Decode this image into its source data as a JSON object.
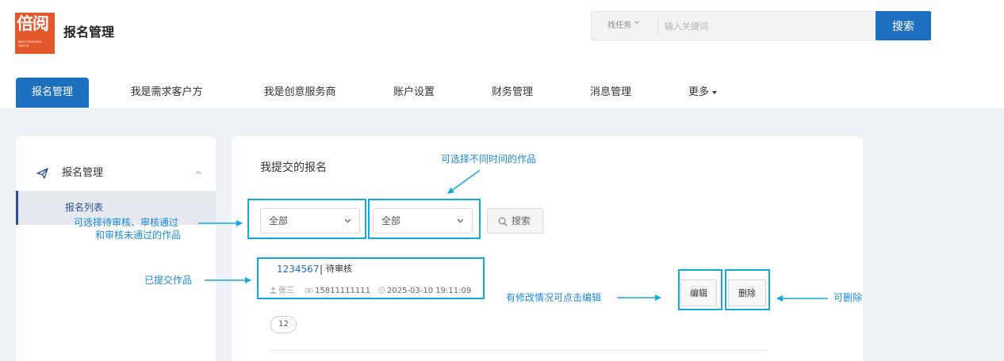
{
  "header": {
    "logo": {
      "glyph": "倍阅",
      "subtitle": "BEST READING SPACE",
      "color": "#e4572a"
    },
    "site_title": "报名管理",
    "search": {
      "scope_label": "找任务",
      "scope_icon": "chevron-down-icon",
      "placeholder": "输入关键词",
      "button_label": "搜索"
    },
    "accent_color": "#1d6fc0"
  },
  "nav": {
    "items": [
      {
        "label": "报名管理",
        "active": true
      },
      {
        "label": "我是需求客户方",
        "active": false
      },
      {
        "label": "我是创意服务商",
        "active": false
      },
      {
        "label": "账户设置",
        "active": false
      },
      {
        "label": "财务管理",
        "active": false
      },
      {
        "label": "消息管理",
        "active": false
      },
      {
        "label": "更多",
        "active": false,
        "icon": "caret-down-icon"
      }
    ]
  },
  "sidebar": {
    "section_title": "报名管理",
    "section_icon": "paper-plane-icon",
    "collapse_icon": "chevron-up-icon",
    "sub_items": [
      {
        "label": "报名列表",
        "active": true
      }
    ]
  },
  "main": {
    "title": "我提交的报名",
    "filters": {
      "status_select": {
        "value": "全部"
      },
      "time_select": {
        "value": "全部"
      },
      "search_button": {
        "label": "搜索",
        "icon": "search-icon"
      }
    },
    "submission": {
      "id": "1234567",
      "separator": "|",
      "status": "待审核",
      "user_icon": "user-icon",
      "user": "张三",
      "phone_icon": "eye-icon",
      "phone": "15811111111",
      "time_icon": "clock-icon",
      "time": "2025-03-10 19:11:09",
      "edit_label": "编辑",
      "delete_label": "删除"
    },
    "pagination": {
      "current": "12"
    }
  },
  "annotations": {
    "filter_status": "可选择待审核、审核通过",
    "filter_status_line2": "和审核未通过的作品",
    "filter_time": "可选择不同时间的作品",
    "submitted_work": "已提交作品",
    "edit_hint": "有修改情况可点击编辑",
    "delete_hint": "可删除",
    "color": "#14a7e0"
  }
}
